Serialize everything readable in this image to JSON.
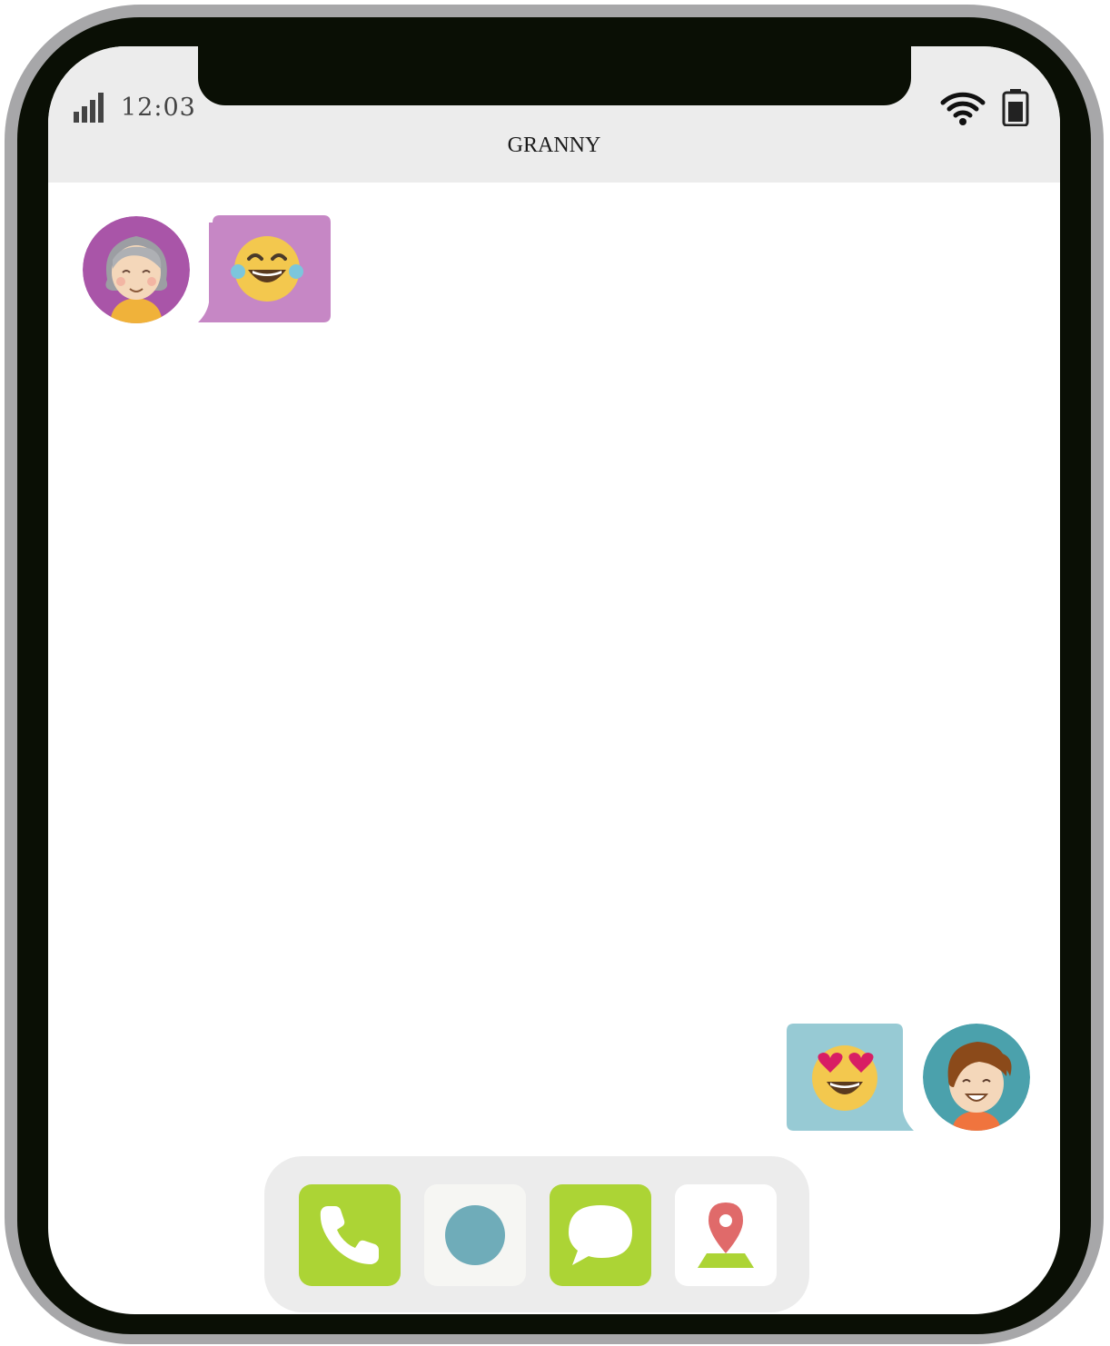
{
  "status_bar": {
    "time": "12:03",
    "signal_icon": "signal-bars-icon",
    "wifi_icon": "wifi-icon",
    "battery_icon": "battery-icon"
  },
  "header": {
    "title": "GRANNY"
  },
  "conversation": {
    "messages": [
      {
        "sender": "granny",
        "avatar": "grandmother-avatar",
        "emoji": "laughing-tears-emoji",
        "bubble_color": "#c687c5"
      },
      {
        "sender": "me",
        "avatar": "child-avatar",
        "emoji": "heart-eyes-emoji",
        "bubble_color": "#97cad4"
      }
    ]
  },
  "dock": {
    "items": [
      {
        "name": "phone",
        "icon": "phone-icon",
        "bg": "#acd435"
      },
      {
        "name": "record",
        "icon": "circle-icon",
        "bg": "#f6f6f3"
      },
      {
        "name": "message",
        "icon": "chat-bubble-icon",
        "bg": "#acd435"
      },
      {
        "name": "location",
        "icon": "map-pin-icon",
        "bg": "#ffffff"
      }
    ]
  },
  "colors": {
    "frame": "#a7a7a9",
    "bezel": "#0a0f05",
    "status_bar_bg": "#ececec",
    "accent_green": "#acd435",
    "accent_teal": "#6facb9",
    "granny_purple": "#a955a8",
    "child_teal": "#4ba1ac"
  }
}
